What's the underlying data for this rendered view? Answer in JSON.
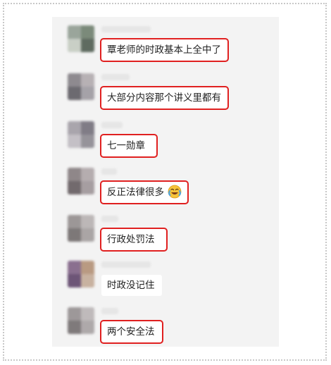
{
  "messages": [
    {
      "text": "覃老师的时政基本上全中了",
      "highlighted": true,
      "emoji": null,
      "avatar_colors": [
        "#9aa59b",
        "#7b8a7a",
        "#c9cfc6",
        "#5f6b60"
      ]
    },
    {
      "text": "大部分内容那个讲义里都有",
      "highlighted": true,
      "emoji": null,
      "avatar_colors": [
        "#8e8a8f",
        "#b7b1b4",
        "#6c6a70",
        "#a5a2a8"
      ]
    },
    {
      "text": "七一勋章",
      "highlighted": true,
      "emoji": null,
      "avatar_colors": [
        "#a9a5ac",
        "#807c86",
        "#c4c0c6",
        "#96939a"
      ]
    },
    {
      "text": "反正法律很多",
      "highlighted": true,
      "emoji": "laughing-crying-emoji",
      "avatar_colors": [
        "#8f8789",
        "#b5adaf",
        "#726a6d",
        "#a69ea1"
      ]
    },
    {
      "text": "行政处罚法",
      "highlighted": true,
      "emoji": null,
      "avatar_colors": [
        "#9c9797",
        "#bcb7b7",
        "#7d7878",
        "#aaa5a5"
      ]
    },
    {
      "text": "时政没记住",
      "highlighted": false,
      "emoji": null,
      "avatar_colors": [
        "#8a6f8f",
        "#b99a82",
        "#6d5577",
        "#c8b2a0"
      ]
    },
    {
      "text": "两个安全法",
      "highlighted": true,
      "emoji": null,
      "avatar_colors": [
        "#9d9899",
        "#bfbabb",
        "#7f7a7b",
        "#aea9aa"
      ]
    }
  ],
  "colors": {
    "panel_bg": "#f3f3f3",
    "bubble_bg": "#ffffff",
    "highlight_border": "#e02020",
    "text": "#222222"
  }
}
